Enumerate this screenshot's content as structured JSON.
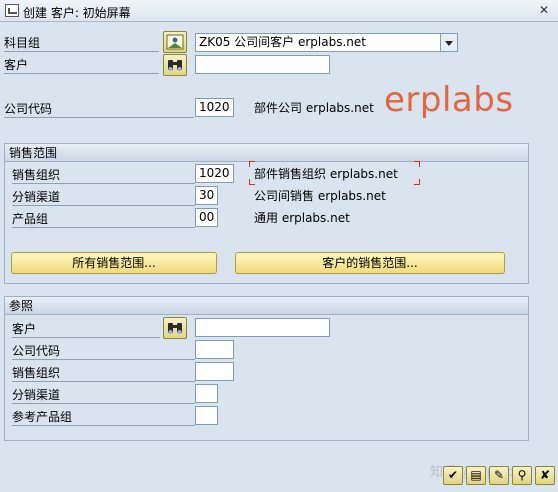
{
  "window": {
    "title": "创建 客户: 初始屏幕",
    "close_glyph": "✕"
  },
  "header": {
    "account_group_label": "科目组",
    "account_group_value": "ZK05 公司间客户 erplabs.net",
    "customer_label": "客户",
    "customer_value": "",
    "company_code_label": "公司代码",
    "company_code_value": "1020",
    "company_code_desc": "部件公司 erplabs.net"
  },
  "brand_text": "erplabs",
  "sales_area": {
    "title": "销售范围",
    "sales_org_label": "销售组织",
    "sales_org_value": "1020",
    "sales_org_desc": "部件销售组织 erplabs.net",
    "dist_channel_label": "分销渠道",
    "dist_channel_value": "30",
    "dist_channel_desc": "公司间销售 erplabs.net",
    "division_label": "产品组",
    "division_value": "00",
    "division_desc": "通用 erplabs.net",
    "all_areas_button": "所有销售范围...",
    "customer_areas_button": "客户的销售范围..."
  },
  "reference": {
    "title": "参照",
    "customer_label": "客户",
    "customer_value": "",
    "company_code_label": "公司代码",
    "company_code_value": "",
    "sales_org_label": "销售组织",
    "sales_org_value": "",
    "dist_channel_label": "分销渠道",
    "dist_channel_value": "",
    "division_label": "参考产品组",
    "division_value": ""
  },
  "toolbar": {
    "icons": [
      "check-icon",
      "data-icon",
      "edit-icon",
      "search-icon",
      "cancel-icon"
    ],
    "glyphs": [
      "✔",
      "▤",
      "✎",
      "⚲",
      "✘"
    ]
  },
  "watermark_text": "知乎 @erplabs"
}
